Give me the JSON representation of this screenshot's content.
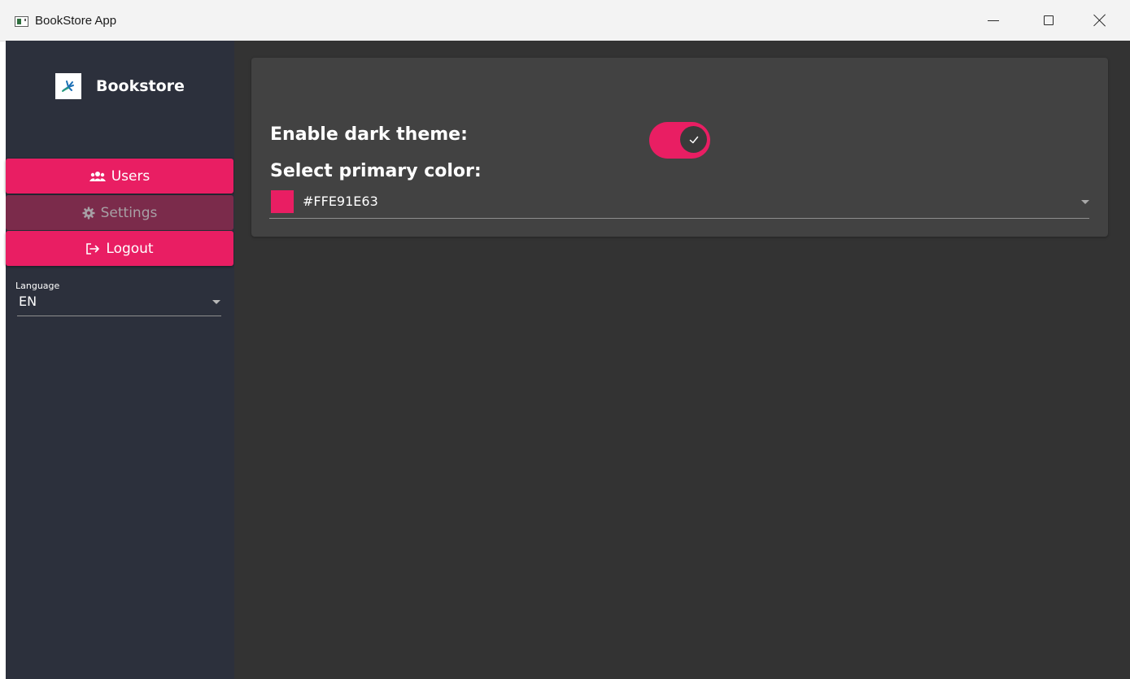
{
  "window": {
    "title": "BookStore App"
  },
  "sidebar": {
    "brand": "Bookstore",
    "items": [
      {
        "label": "Users",
        "icon": "users-icon",
        "state": "normal"
      },
      {
        "label": "Settings",
        "icon": "gear-icon",
        "state": "selected"
      },
      {
        "label": "Logout",
        "icon": "logout-icon",
        "state": "normal"
      }
    ],
    "language": {
      "label": "Language",
      "value": "EN"
    }
  },
  "settings": {
    "dark_theme_label": "Enable dark theme:",
    "dark_theme_enabled": true,
    "primary_color_label": "Select primary color:",
    "primary_color_value": "#FFE91E63"
  },
  "colors": {
    "accent": "#E91E63",
    "sidebar_bg": "#2C303C",
    "main_bg": "#333333",
    "card_bg": "#424242"
  }
}
